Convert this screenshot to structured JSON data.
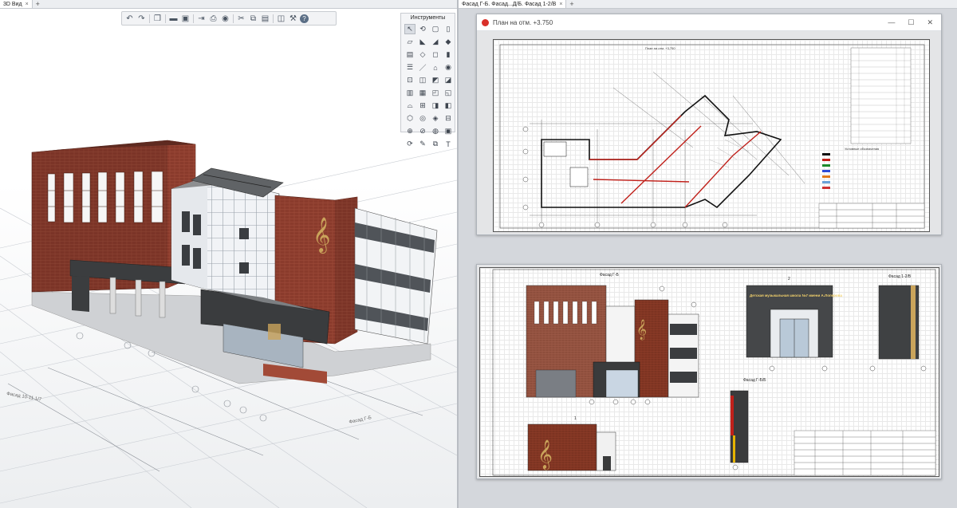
{
  "tabs_left": {
    "active": "3D Вид",
    "add": "+",
    "close": "×"
  },
  "tabs_right": {
    "active": "Фасад Г-Б. Фасад...Д/Б. Фасад 1-2/В",
    "add": "+",
    "close": "×"
  },
  "toolbar": {
    "icons": [
      "undo-icon",
      "redo-icon",
      "cube-view-icon",
      "folder-icon",
      "save-icon",
      "export-icon",
      "print-icon",
      "visibility-icon",
      "cut-icon",
      "copy-icon",
      "paste-icon",
      "layers-icon",
      "wrench-icon",
      "help-icon"
    ]
  },
  "tools_panel": {
    "title": "Инструменты",
    "tools": [
      "↖",
      "⟲",
      "▢",
      "▯",
      "▱",
      "◣",
      "◢",
      "◆",
      "▤",
      "◇",
      "◻",
      "▮",
      "☰",
      "／",
      "⌂",
      "◉",
      "⊡",
      "◫",
      "◩",
      "◪",
      "▥",
      "▦",
      "◰",
      "◱",
      "⌓",
      "⊞",
      "◨",
      "◧",
      "⬡",
      "◎",
      "◈",
      "⊟",
      "⊕",
      "⊘",
      "◍",
      "▣",
      "⟳",
      "✎",
      "⧉",
      "T"
    ]
  },
  "plan_window": {
    "title": "План на отм. +3.750",
    "controls": {
      "minimize": "—",
      "maximize": "☐",
      "close": "✕"
    },
    "sheet_title": "План на отм. +3,750",
    "legend_title": "Условные обозначения"
  },
  "facade_sheet": {
    "label_main": "Фасад Г-Б",
    "label_side": "Фасад 1-2/В",
    "label_small": "Фасад Г-Б/Б",
    "label_num2": "2",
    "label_num1": "1",
    "sign_text": "Детская музыкальная школа №7 имени А.Лоперова"
  },
  "axes_3d": {
    "label_a": "Фасад 10-11 1/7",
    "label_b": "Фасад Г-Б"
  },
  "colors": {
    "brick": "#7a3326",
    "brick_light": "#a24a37",
    "dark_panel": "#3a3b3c",
    "white_panel": "#eef1f4",
    "accent_red": "#d9302a"
  }
}
